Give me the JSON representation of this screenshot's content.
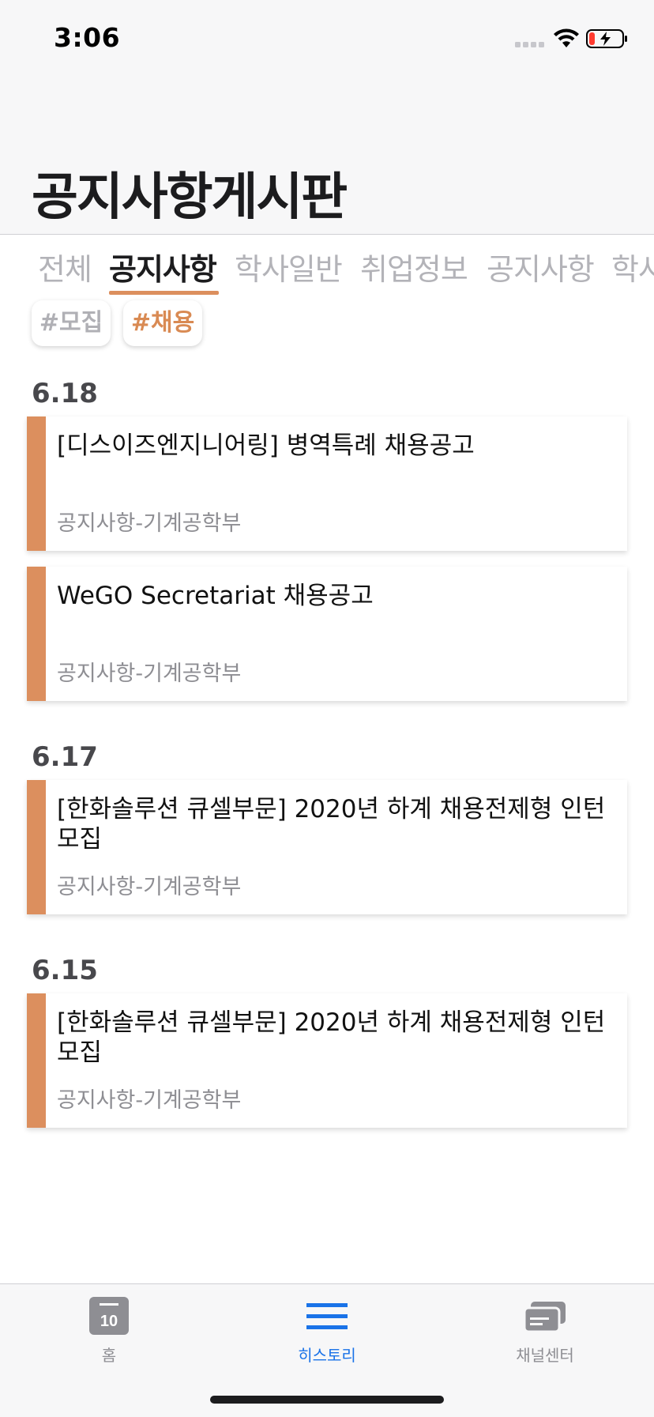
{
  "status_bar": {
    "time": "3:06",
    "icons": [
      "signal-icon",
      "wifi-icon",
      "battery-low-charging-icon"
    ]
  },
  "page": {
    "title": "공지사항게시판"
  },
  "category_tabs": [
    {
      "label": "전체",
      "active": false
    },
    {
      "label": "공지사항",
      "active": true
    },
    {
      "label": "학사일반",
      "active": false
    },
    {
      "label": "취업정보",
      "active": false
    },
    {
      "label": "공지사항",
      "active": false
    },
    {
      "label": "학사",
      "active": false
    }
  ],
  "tags": [
    {
      "label": "#모집",
      "selected": false
    },
    {
      "label": "#채용",
      "selected": true
    }
  ],
  "groups": [
    {
      "date": "6.18",
      "posts": [
        {
          "title": "[디스이즈엔지니어링] 병역특례 채용공고",
          "source": "공지사항-기계공학부"
        },
        {
          "title": "WeGO Secretariat 채용공고",
          "source": "공지사항-기계공학부"
        }
      ]
    },
    {
      "date": "6.17",
      "posts": [
        {
          "title": "[한화솔루션 큐셀부문] 2020년 하계 채용전제형 인턴 모집",
          "source": "공지사항-기계공학부"
        }
      ]
    },
    {
      "date": "6.15",
      "posts": [
        {
          "title": "[한화솔루션 큐셀부문] 2020년 하계 채용전제형 인턴 모집",
          "source": "공지사항-기계공학부"
        }
      ]
    }
  ],
  "tab_bar": [
    {
      "label": "홈",
      "icon": "calendar-icon",
      "badge": "10",
      "active": false
    },
    {
      "label": "히스토리",
      "icon": "menu-lines-icon",
      "active": true
    },
    {
      "label": "채널센터",
      "icon": "stacked-cards-icon",
      "active": false
    }
  ],
  "colors": {
    "accent": "#dc8f5e",
    "active_tab_blue": "#1a73e8",
    "inactive_text": "#b3b3b8"
  }
}
